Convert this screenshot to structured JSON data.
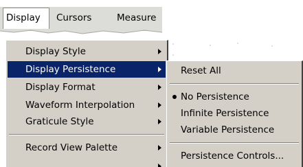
{
  "menubar": {
    "items": [
      {
        "label": "Display"
      },
      {
        "label": "Cursors"
      },
      {
        "label": "Measure"
      }
    ]
  },
  "display_menu": {
    "items": [
      {
        "label": "Display Style",
        "has_submenu": true
      },
      {
        "label": "Display Persistence",
        "has_submenu": true,
        "highlighted": true
      },
      {
        "label": "Display Format",
        "has_submenu": true
      },
      {
        "label": "Waveform Interpolation",
        "has_submenu": true
      },
      {
        "label": "Graticule Style",
        "has_submenu": true
      },
      {
        "label": "Record View Palette",
        "has_submenu": true
      }
    ]
  },
  "persistence_submenu": {
    "items": [
      {
        "label": "Reset All"
      },
      {
        "label": "No Persistence",
        "checked": true
      },
      {
        "label": "Infinite Persistence"
      },
      {
        "label": "Variable Persistence"
      },
      {
        "label": "Persistence Controls..."
      }
    ]
  },
  "colors": {
    "menu_bg": "#d4d0c8",
    "highlight_bg": "#0a246a",
    "highlight_text": "#ffffff"
  }
}
